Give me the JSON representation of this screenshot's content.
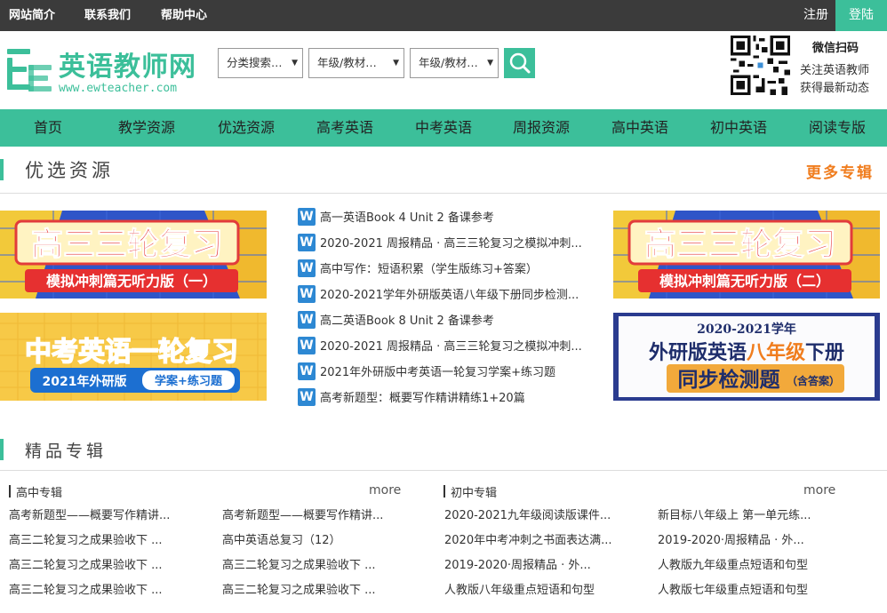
{
  "topbar": {
    "links": [
      "网站简介",
      "联系我们",
      "帮助中心"
    ],
    "register": "注册",
    "login": "登陆"
  },
  "header": {
    "logo_name": "英语教师网",
    "logo_url": "www.ewteacher.com",
    "selects": [
      "分类搜索…",
      "年级/教材…",
      "年级/教材…"
    ],
    "search_icon": "search-icon",
    "wechat_title": "微信扫码",
    "wechat_line1": "关注英语教师",
    "wechat_line2": "获得最新动态"
  },
  "nav": [
    "首页",
    "教学资源",
    "优选资源",
    "高考英语",
    "中考英语",
    "周报资源",
    "高中英语",
    "初中英语",
    "阅读专版"
  ],
  "featured": {
    "title": "优选资源",
    "more": "更多专辑",
    "banners": [
      {
        "main": "高三三轮复习",
        "sub": "模拟冲刺篇无听力版（一）"
      },
      {
        "main": "中考英语一轮复习",
        "sub1": "2021年外研版",
        "sub2": "学案+练习题"
      },
      {
        "main": "高三三轮复习",
        "sub": "模拟冲刺篇无听力版（二）"
      },
      {
        "line1": "2020-2021学年",
        "line2a": "外研版英语",
        "line2b": "八年级",
        "line2c": "下册",
        "line3": "同步检测题",
        "line3b": "（含答案）"
      }
    ],
    "items": [
      "高一英语Book 4 Unit 2 备课参考",
      "2020-2021 周报精品 · 高三三轮复习之模拟冲刺...",
      "高中写作：短语积累（学生版练习+答案）",
      "2020-2021学年外研版英语八年级下册同步检测...",
      "高二英语Book 8 Unit 2 备课参考",
      "2020-2021 周报精品 · 高三三轮复习之模拟冲刺...",
      "2021年外研版中考英语一轮复习学案+练习题",
      "高考新题型：概要写作精讲精练1+20篇"
    ]
  },
  "albums": {
    "title": "精品专辑",
    "columns": [
      {
        "heading": "高中专辑",
        "more": "more",
        "left": [
          "高考新题型——概要写作精讲...",
          "高三二轮复习之成果验收下 ...",
          "高三二轮复习之成果验收下 ...",
          "高三二轮复习之成果验收下 ..."
        ],
        "right": [
          "高考新题型——概要写作精讲...",
          "高中英语总复习（12）",
          "高三二轮复习之成果验收下 ...",
          "高三二轮复习之成果验收下 ..."
        ]
      },
      {
        "heading": "初中专辑",
        "more": "more",
        "left": [
          "2020-2021九年级阅读版课件...",
          "2020年中考冲刺之书面表达满...",
          "2019-2020·周报精品 · 外...",
          "人教版八年级重点短语和句型"
        ],
        "right": [
          "新目标八年级上 第一单元练...",
          "2019-2020·周报精品 · 外...",
          "人教版九年级重点短语和句型",
          "人教版七年级重点短语和句型"
        ]
      }
    ]
  },
  "colors": {
    "accent": "#3cbf9a",
    "topbar": "#3b3b3b",
    "orange": "#f07d1e",
    "w_icon": "#2d88d3"
  }
}
